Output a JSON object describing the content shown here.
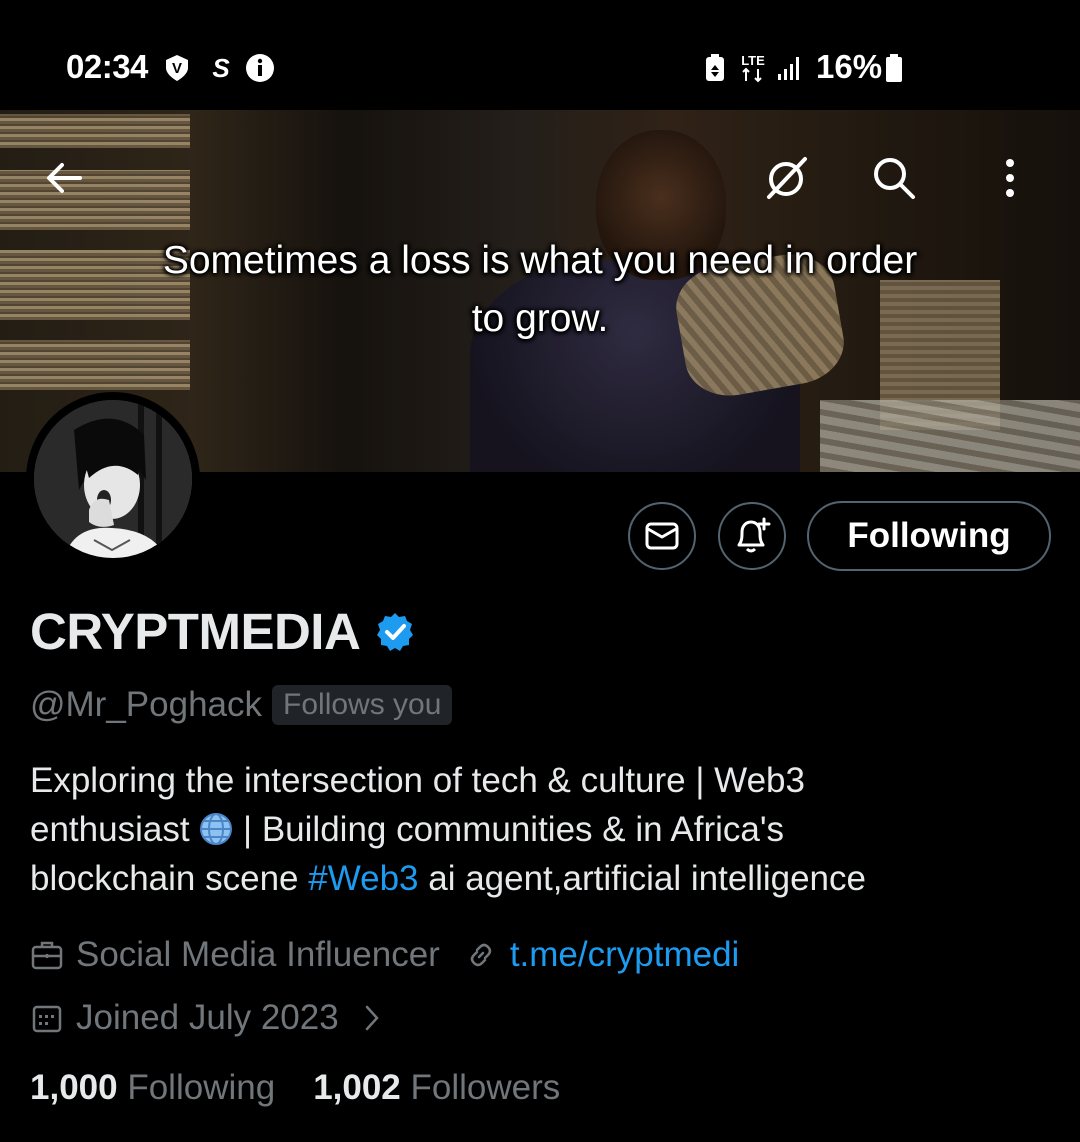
{
  "status_bar": {
    "time": "02:34",
    "left_icons": [
      "vpn-v-icon",
      "s-app-icon",
      "info-icon"
    ],
    "network": "LTE",
    "battery": "16%"
  },
  "banner": {
    "caption_line1": "Sometimes a loss is what you need in order",
    "caption_line2": "to grow."
  },
  "nav": {
    "icons": [
      "back-arrow-icon",
      "grok-icon",
      "search-icon",
      "more-vertical-icon"
    ]
  },
  "actions": {
    "message_icon": "mail-icon",
    "notify_icon": "bell-plus-icon",
    "following_label": "Following"
  },
  "profile": {
    "name": "CRYPTMEDIA",
    "handle": "@Mr_Poghack",
    "follows_you": "Follows you",
    "bio_part1": "Exploring the intersection of tech & culture | Web3",
    "bio_part2": "enthusiast",
    "bio_part3": " | Building communities &  in Africa's",
    "bio_part4": "blockchain scene ",
    "bio_hashtag": "#Web3",
    "bio_part5": "  ai agent,artificial intelligence",
    "category": "Social Media Influencer",
    "link": "t.me/cryptmedi",
    "joined": "Joined July 2023",
    "following_count": "1,000",
    "following_label": "Following",
    "followers_count": "1,002",
    "followers_label": "Followers"
  },
  "colors": {
    "accent": "#1d9bf0",
    "muted": "#71767b",
    "text": "#e7e9ea",
    "border": "#536471",
    "background": "#000000"
  }
}
